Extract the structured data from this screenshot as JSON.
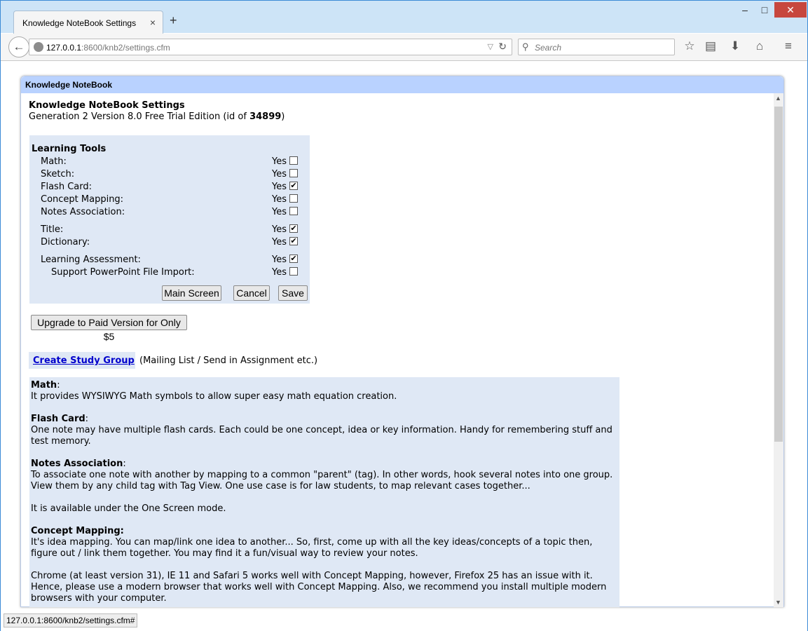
{
  "browser": {
    "tab_title": "Knowledge NoteBook Settings",
    "tab_close": "×",
    "new_tab": "+",
    "url_host": "127.0.0.1",
    "url_rest": ":8600/knb2/settings.cfm",
    "search_placeholder": "Search",
    "status_url": "127.0.0.1:8600/knb2/settings.cfm#"
  },
  "panel": {
    "header": "Knowledge NoteBook",
    "title": "Knowledge NoteBook Settings",
    "version_text": "Generation 2 Version 8.0 Free Trial Edition (id of ",
    "id": "34899",
    "version_suffix": ")"
  },
  "learning_tools": {
    "heading": "Learning Tools",
    "yes": "Yes",
    "items": [
      {
        "label": "Math:",
        "checked": false
      },
      {
        "label": "Sketch:",
        "checked": false
      },
      {
        "label": "Flash Card:",
        "checked": true
      },
      {
        "label": "Concept Mapping:",
        "checked": false
      },
      {
        "label": "Notes Association:",
        "checked": false
      },
      {
        "label": "Title:",
        "checked": true
      },
      {
        "label": "Dictionary:",
        "checked": true
      },
      {
        "label": "Learning Assessment:",
        "checked": true
      },
      {
        "label": "Support PowerPoint File Import:",
        "checked": false
      }
    ],
    "buttons": {
      "main": "Main Screen",
      "cancel": "Cancel",
      "save": "Save"
    }
  },
  "upgrade_button": "Upgrade to Paid Version for Only $5",
  "study_group": {
    "link": "Create Study Group",
    "note": "(Mailing List / Send in Assignment etc.)"
  },
  "descriptions": {
    "math_h": "Math",
    "math_t": "It provides WYSIWYG Math symbols to allow super easy math equation creation.",
    "flash_h": "Flash Card",
    "flash_t": "One note may have multiple flash cards. Each could be one concept, idea or key information. Handy for remembering stuff and test memory.",
    "notes_h": "Notes Association",
    "notes_t": "To associate one note with another by mapping to a common \"parent\" (tag). In other words, hook several notes into one group. View them by any child tag with Tag View. One use case is for law students, to map relevant cases together...",
    "notes_t2": "It is available under the One Screen mode.",
    "concept_h": "Concept Mapping:",
    "concept_t": "It's idea mapping. You can map/link one idea to another... So, first, come up with all the key ideas/concepts of a topic then, figure out / link them together. You may find it a fun/visual way to review your notes.",
    "concept_t2": "Chrome (at least version 31), IE 11 and Safari 5 works well with Concept Mapping, however, Firefox 25 has an issue with it. Hence, please use a modern browser that works well with Concept Mapping. Also, we recommend you install multiple modern browsers with your computer."
  }
}
